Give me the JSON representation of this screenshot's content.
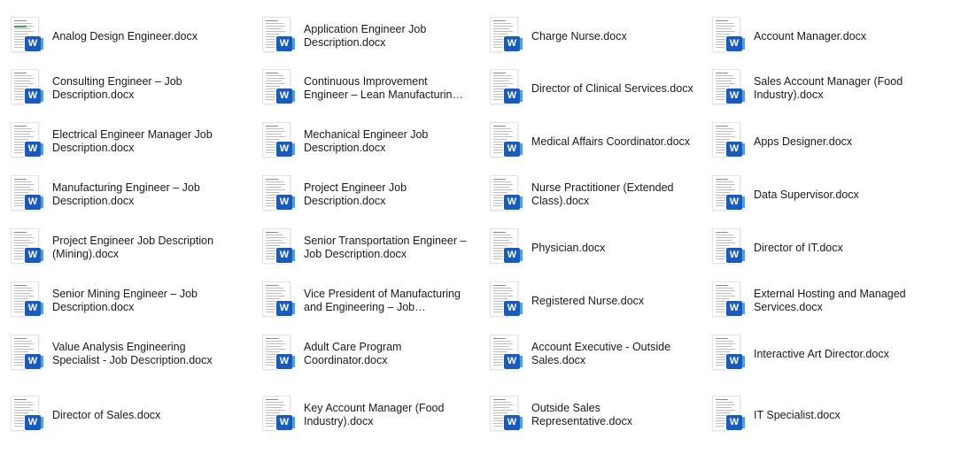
{
  "files": [
    {
      "name": "Analog Design Engineer.docx"
    },
    {
      "name": "Consulting Engineer – Job Description.docx"
    },
    {
      "name": "Electrical Engineer Manager Job Description.docx"
    },
    {
      "name": "Manufacturing Engineer – Job Description.docx"
    },
    {
      "name": "Project Engineer Job Description (Mining).docx"
    },
    {
      "name": "Senior Mining Engineer – Job Description.docx"
    },
    {
      "name": "Value Analysis Engineering Specialist - Job Description.docx"
    },
    {
      "name": "Director of Sales.docx"
    },
    {
      "name": "Application Engineer Job Description.docx"
    },
    {
      "name": "Continuous Improvement Engineer – Lean Manufacturing –..."
    },
    {
      "name": "Mechanical Engineer Job Description.docx"
    },
    {
      "name": "Project Engineer Job Description.docx"
    },
    {
      "name": "Senior Transportation Engineer – Job Description.docx"
    },
    {
      "name": "Vice President of Manufacturing and Engineering – Job Descriptio..."
    },
    {
      "name": "Adult Care Program Coordinator.docx"
    },
    {
      "name": "Key Account Manager (Food Industry).docx"
    },
    {
      "name": "Charge Nurse.docx"
    },
    {
      "name": "Director of Clinical Services.docx"
    },
    {
      "name": "Medical Affairs Coordinator.docx"
    },
    {
      "name": "Nurse Practitioner (Extended Class).docx"
    },
    {
      "name": "Physician.docx"
    },
    {
      "name": "Registered Nurse.docx"
    },
    {
      "name": "Account Executive - Outside Sales.docx"
    },
    {
      "name": "Outside Sales Representative.docx"
    },
    {
      "name": "Account Manager.docx"
    },
    {
      "name": "Sales Account Manager (Food Industry).docx"
    },
    {
      "name": "Apps Designer.docx"
    },
    {
      "name": "Data Supervisor.docx"
    },
    {
      "name": "Director of IT.docx"
    },
    {
      "name": "External Hosting and Managed Services.docx"
    },
    {
      "name": "Interactive Art Director.docx"
    },
    {
      "name": "IT Specialist.docx"
    }
  ],
  "icons": {
    "file_type_badge": "word-icon",
    "badge_letter": "W",
    "badge_color": "#185abd"
  }
}
